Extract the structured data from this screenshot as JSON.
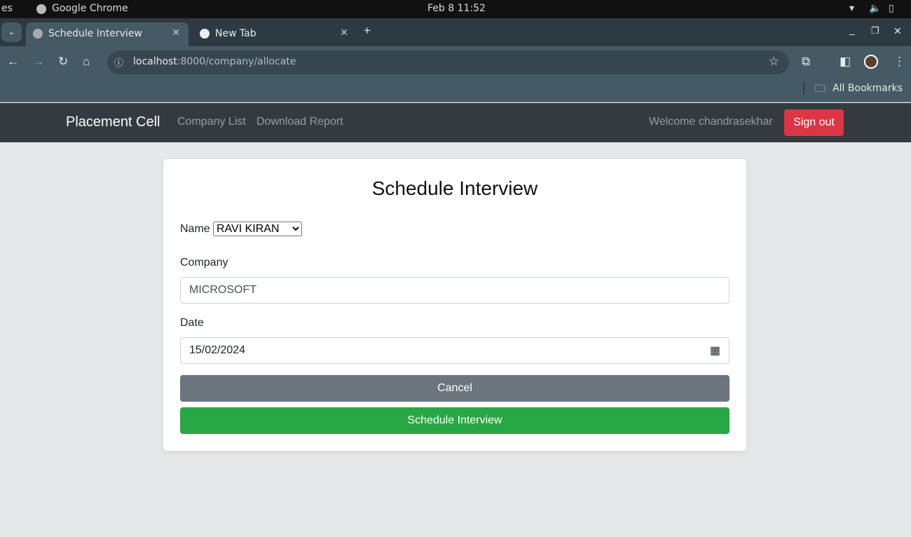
{
  "system": {
    "activities": "es",
    "app": "Google Chrome",
    "datetime": "Feb 8  11:52"
  },
  "browser": {
    "tabs": [
      {
        "title": "Schedule Interview",
        "active": true
      },
      {
        "title": "New Tab",
        "active": false
      }
    ],
    "url_host": "localhost",
    "url_path": ":8000/company/allocate",
    "bookmarks_label": "All Bookmarks"
  },
  "navbar": {
    "brand": "Placement Cell",
    "links": [
      "Company List",
      "Download Report"
    ],
    "welcome": "Welcome chandrasekhar",
    "signout": "Sign out"
  },
  "form": {
    "title": "Schedule Interview",
    "name_label": "Name",
    "name_selected": "RAVI KIRAN",
    "company_label": "Company",
    "company_value": "MICROSOFT",
    "date_label": "Date",
    "date_value": "15/02/2024",
    "cancel": "Cancel",
    "submit": "Schedule Interview"
  },
  "colors": {
    "navbar": "#343a40",
    "signout": "#dc3545",
    "cancel": "#6c757d",
    "submit": "#28a745"
  }
}
